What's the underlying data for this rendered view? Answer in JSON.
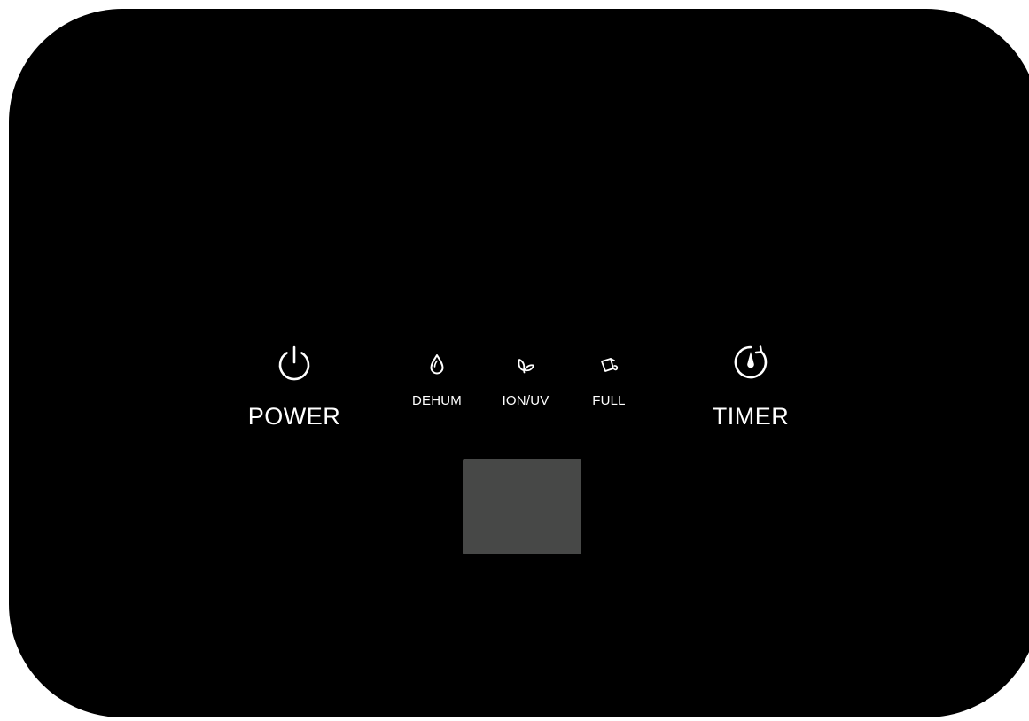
{
  "panel": {
    "background_color": "#000000",
    "display_color": "#474847",
    "text_color": "#ffffff"
  },
  "controls": {
    "power": {
      "label": "POWER",
      "icon": "power-icon"
    },
    "timer": {
      "label": "TIMER",
      "icon": "timer-icon"
    }
  },
  "indicators": [
    {
      "label": "DEHUM",
      "icon": "water-drop-icon"
    },
    {
      "label": "ION/UV",
      "icon": "leaf-icon"
    },
    {
      "label": "FULL",
      "icon": "bucket-icon"
    }
  ]
}
